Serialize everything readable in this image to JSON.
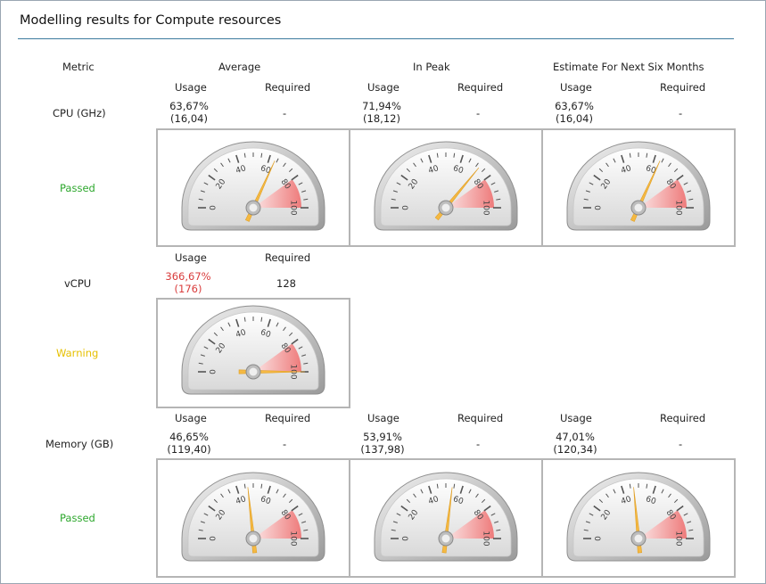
{
  "title": "Modelling results for Compute resources",
  "headers": {
    "metric": "Metric",
    "average": "Average",
    "peak": "In Peak",
    "estimate": "Estimate For Next Six Months",
    "usage": "Usage",
    "required": "Required"
  },
  "gauge": {
    "tick_labels": [
      "0",
      "20",
      "40",
      "60",
      "80",
      "100"
    ],
    "min": 0,
    "max": 100,
    "warning_zone": [
      80,
      100
    ]
  },
  "colors": {
    "passed": "#2ea82e",
    "warning": "#e6c000",
    "over_limit_value": "#d93c3c",
    "needle": "#f5b942",
    "header_rule": "#3c7a9e"
  },
  "rows": {
    "cpu": {
      "label": "CPU (GHz)",
      "status": "Passed",
      "cells": [
        {
          "usage_pct": "63,67%",
          "usage_abs": "(16,04)",
          "required": "-",
          "needle_value": 63.67
        },
        {
          "usage_pct": "71,94%",
          "usage_abs": "(18,12)",
          "required": "-",
          "needle_value": 71.94
        },
        {
          "usage_pct": "63,67%",
          "usage_abs": "(16,04)",
          "required": "-",
          "needle_value": 63.67
        }
      ]
    },
    "vcpu": {
      "label": "vCPU",
      "status": "Warning",
      "cells": [
        {
          "usage_pct": "366,67%",
          "usage_abs": "(176)",
          "required": "128",
          "needle_value": 100
        }
      ]
    },
    "memory": {
      "label": "Memory (GB)",
      "status": "Passed",
      "cells": [
        {
          "usage_pct": "46,65%",
          "usage_abs": "(119,40)",
          "required": "-",
          "needle_value": 46.65
        },
        {
          "usage_pct": "53,91%",
          "usage_abs": "(137,98)",
          "required": "-",
          "needle_value": 53.91
        },
        {
          "usage_pct": "47,01%",
          "usage_abs": "(120,34)",
          "required": "-",
          "needle_value": 47.01
        }
      ]
    }
  }
}
